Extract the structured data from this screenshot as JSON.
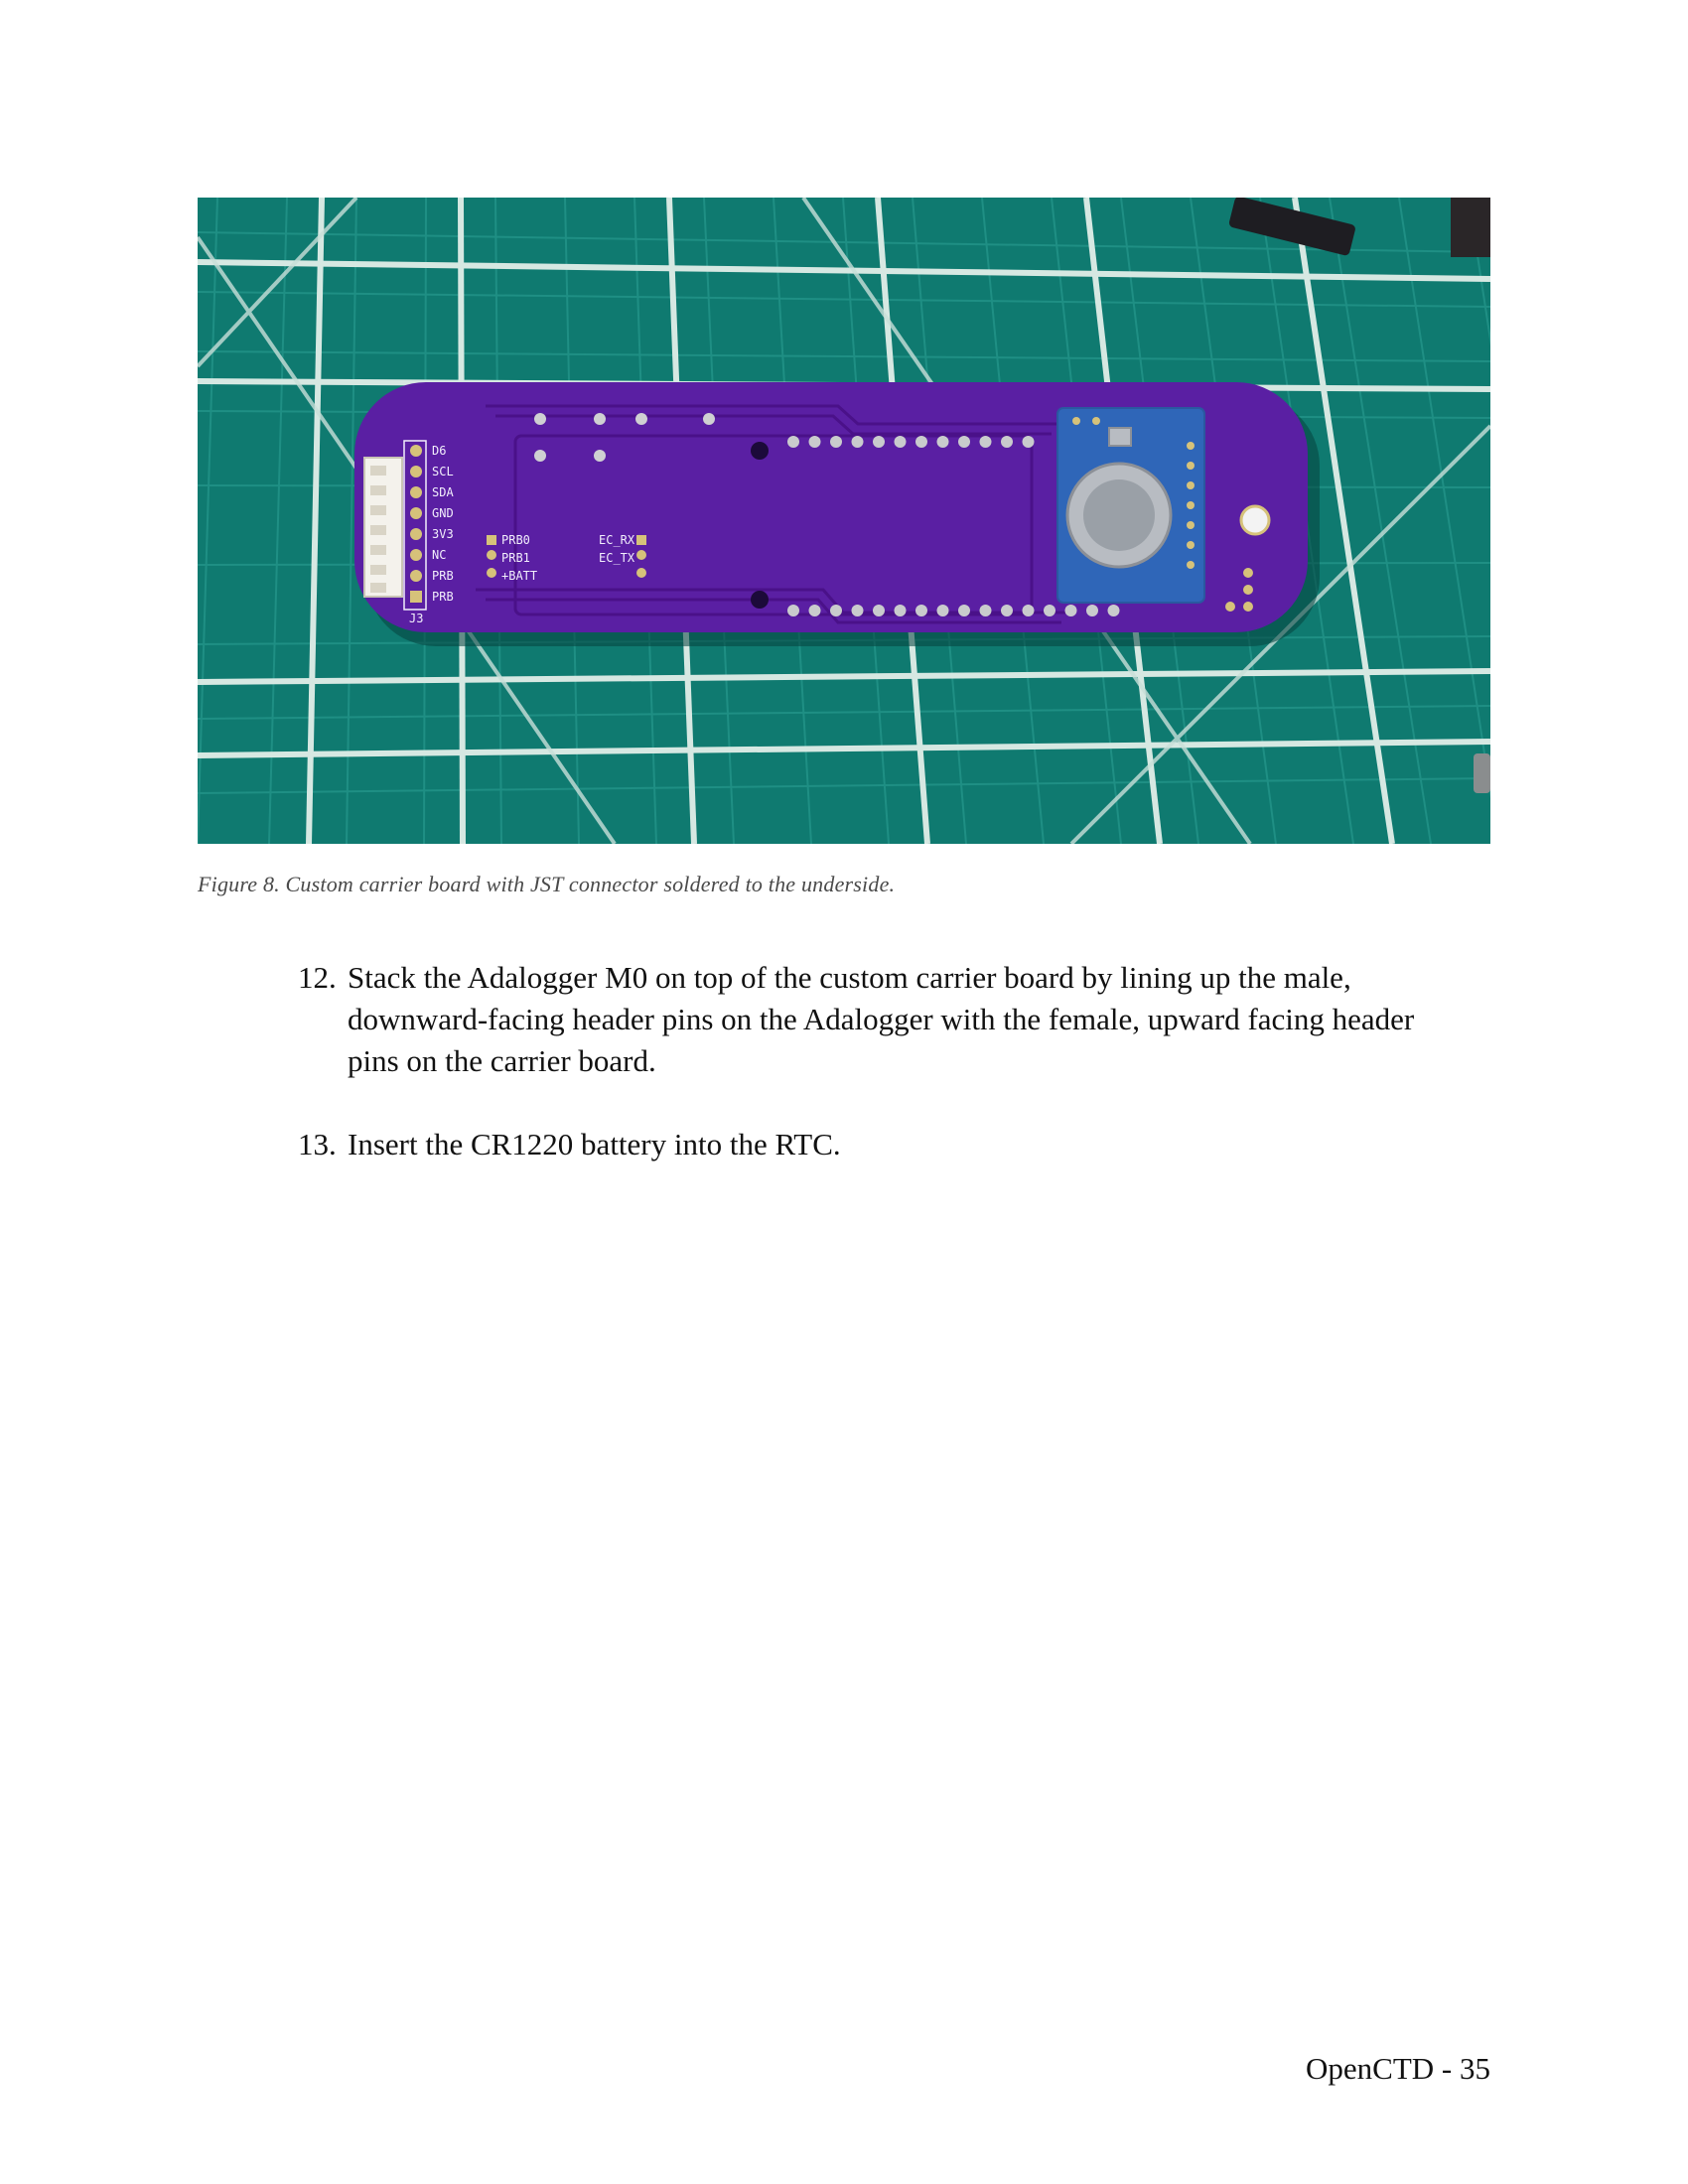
{
  "figure": {
    "caption": "Figure 8. Custom carrier board with JST connector soldered to the underside.",
    "board_labels": {
      "header_pins": [
        "D6",
        "SCL",
        "SDA",
        "GND",
        "3V3",
        "NC",
        "PRB",
        "PRB"
      ],
      "header_designator": "J3",
      "probe_pads": [
        "PRB0",
        "PRB1",
        "+BATT"
      ],
      "ec_pads": [
        "EC_RX",
        "EC_TX"
      ]
    }
  },
  "steps": [
    {
      "number": "12.",
      "text": "Stack the Adalogger M0 on top of the custom carrier board by lining up the male, downward-facing header pins on the Adalogger with the female, upward facing header pins on the carrier board."
    },
    {
      "number": "13.",
      "text": "Insert the CR1220 battery into the RTC."
    }
  ],
  "footer": {
    "page_label": "OpenCTD - 35"
  },
  "colors": {
    "mat": "#0f7a70",
    "grid": "#d6e8e2",
    "board": "#5a1fa3",
    "rtc_module": "#2f66b8",
    "pads": "#d6c27a"
  }
}
